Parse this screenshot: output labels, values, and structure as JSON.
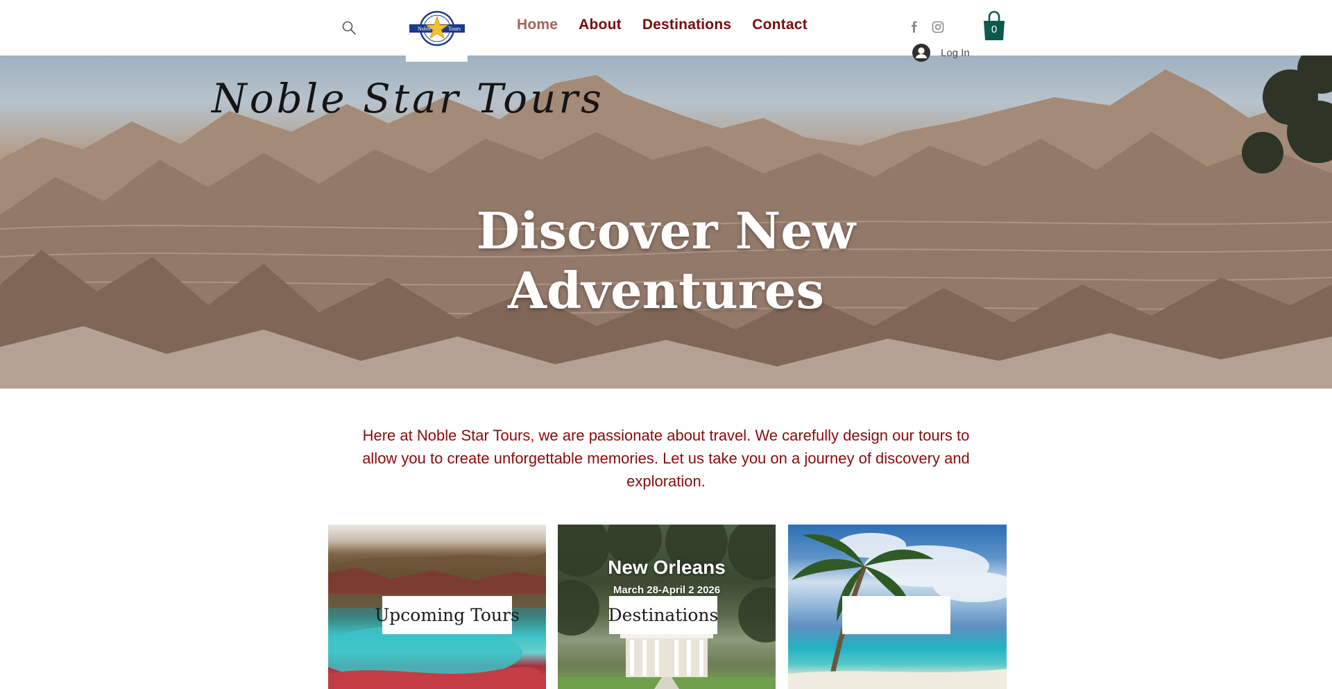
{
  "header": {
    "logo_text_left": "Noble",
    "logo_text_right": "Tours",
    "nav": [
      {
        "label": "Home",
        "active": true
      },
      {
        "label": "About",
        "active": false
      },
      {
        "label": "Destinations",
        "active": false
      },
      {
        "label": "Contact",
        "active": false
      }
    ],
    "social": [
      "facebook-icon",
      "instagram-icon"
    ],
    "cart_count": "0",
    "login_label": "Log In"
  },
  "hero": {
    "brand": "Noble Star Tours",
    "title_line1": "Discover New",
    "title_line2": "Adventures"
  },
  "intro": {
    "text": "Here at Noble Star Tours, we are passionate about travel. We carefully design our tours to allow you to create unforgettable memories. Let us take you on a journey of discovery and exploration."
  },
  "cards": [
    {
      "label": "Upcoming Tours"
    },
    {
      "label": "Destinations",
      "overlay_title": "New Orleans",
      "overlay_date": "March 28-April 2 2026"
    },
    {
      "label": ""
    }
  ],
  "colors": {
    "nav_text": "#7a0a0a",
    "nav_active": "#a5655a",
    "intro_text": "#8a0b0b",
    "cart": "#0d5a4d"
  }
}
